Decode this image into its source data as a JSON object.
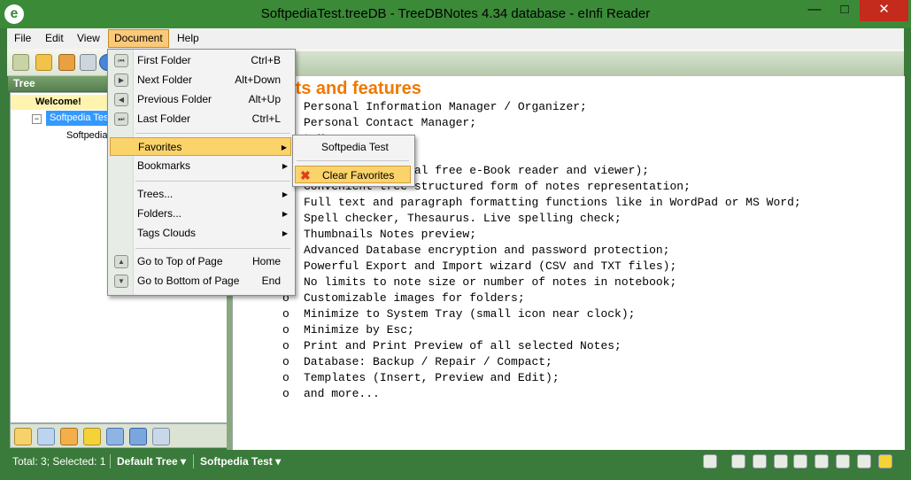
{
  "window": {
    "title": "SoftpediaTest.treeDB - TreeDBNotes 4.34 database - eInfi Reader",
    "app_icon": "e",
    "minimize": "—",
    "maximize": "□",
    "close": "✕"
  },
  "menubar": [
    "File",
    "Edit",
    "View",
    "Document",
    "Help"
  ],
  "tree": {
    "header": "Tree",
    "nodes": [
      "Welcome!",
      "Softpedia Test",
      "Softpedia"
    ]
  },
  "document_menu": {
    "items": [
      {
        "label": "First Folder",
        "shortcut": "Ctrl+B"
      },
      {
        "label": "Next Folder",
        "shortcut": "Alt+Down"
      },
      {
        "label": "Previous Folder",
        "shortcut": "Alt+Up"
      },
      {
        "label": "Last Folder",
        "shortcut": "Ctrl+L"
      },
      {
        "label": "Favorites"
      },
      {
        "label": "Bookmarks"
      },
      {
        "label": "Trees..."
      },
      {
        "label": "Folders..."
      },
      {
        "label": "Tags Clouds"
      },
      {
        "label": "Go to Top of Page",
        "shortcut": "Home"
      },
      {
        "label": "Go to Bottom of Page",
        "shortcut": "End"
      }
    ],
    "arrow": "▶"
  },
  "favorites_submenu": {
    "items": [
      "Softpedia Test",
      "Clear Favorites"
    ]
  },
  "note": {
    "heading": "its and features",
    "bullet": "o",
    "features": [
      "Personal Information Manager / Organizer;",
      "Personal Contact Manager;",
      "t Manager;",
      "",
      "d reader (Internal free e-Book reader and viewer);",
      "Convenient tree structured form of notes representation;",
      "Full text and paragraph formatting functions like in WordPad or MS Word;",
      "Spell checker, Thesaurus. Live spelling check;",
      "Thumbnails Notes preview;",
      "Advanced Database encryption and password protection;",
      "Powerful Export and Import wizard (CSV and TXT files);",
      "No limits to note size or number of notes in notebook;",
      "Customizable images for folders;",
      "Minimize to System Tray (small icon near clock);",
      "Minimize by Esc;",
      "Print and Print Preview of all selected Notes;",
      "Database: Backup / Repair / Compact;",
      "Templates (Insert, Preview and Edit);",
      "and more..."
    ]
  },
  "status": {
    "total": "Total: 3; Selected: 1",
    "tree_selector": "Default Tree ▾",
    "db_selector": "Softpedia Test ▾"
  },
  "colors": {
    "accent_green": "#3b8a38",
    "heading_orange": "#f07800",
    "menu_highlight": "#fbd36b",
    "selection_blue": "#3399ff"
  }
}
